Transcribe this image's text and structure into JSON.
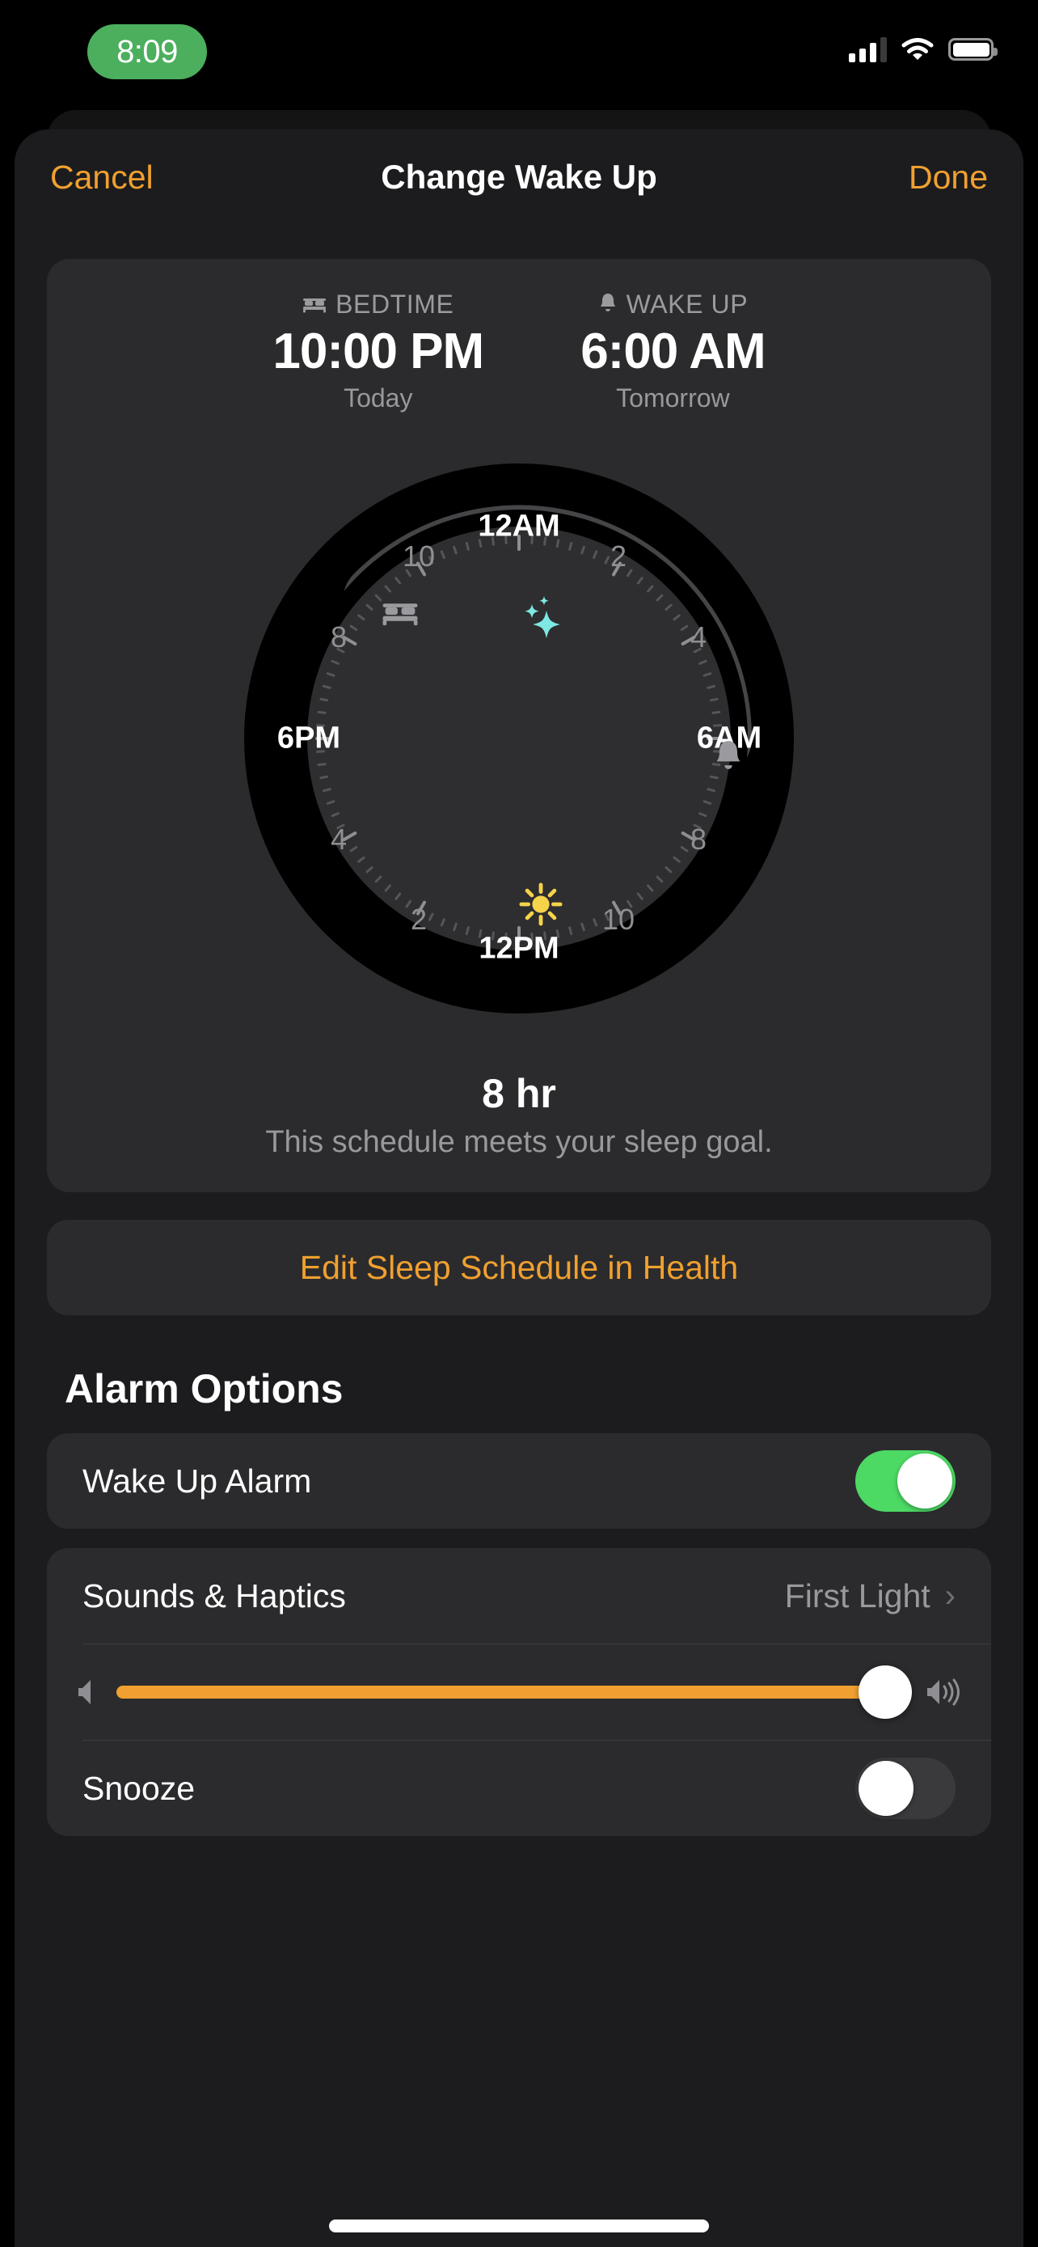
{
  "status_bar": {
    "time": "8:09",
    "time_pill_color": "#4CAF5E",
    "cellular_icon": "cellular-bars-icon",
    "wifi_icon": "wifi-icon",
    "battery_icon": "battery-full-icon"
  },
  "nav": {
    "cancel_label": "Cancel",
    "title": "Change Wake Up",
    "done_label": "Done",
    "accent_color": "#F0A030"
  },
  "schedule": {
    "bedtime": {
      "icon": "bed-icon",
      "header": "BEDTIME",
      "time": "10:00 PM",
      "day": "Today"
    },
    "wakeup": {
      "icon": "bell-icon",
      "header": "WAKE UP",
      "time": "6:00 AM",
      "day": "Tomorrow"
    }
  },
  "dial": {
    "labels": {
      "top": "12AM",
      "top_suffix": "AM",
      "right": "6AM",
      "bottom": "12PM",
      "left": "6PM",
      "minor": [
        "2",
        "4",
        "8",
        "10"
      ]
    },
    "night_icon": "sparkles-icon",
    "night_icon_color": "#7EE8E2",
    "day_icon": "sun-icon",
    "day_icon_color": "#F5D34A",
    "bedtime_handle_icon": "bed-icon",
    "wakeup_handle_icon": "bell-icon",
    "arc_start_hour": 22,
    "arc_end_hour": 6,
    "track_color": "#454548",
    "ring_color": "#000000",
    "face_color": "#2e2e30"
  },
  "duration": {
    "value": "8 hr",
    "note": "This schedule meets your sleep goal."
  },
  "edit_button": {
    "label": "Edit Sleep Schedule in Health"
  },
  "alarm_options": {
    "section_title": "Alarm Options",
    "wake_up_alarm": {
      "label": "Wake Up Alarm",
      "enabled": true
    },
    "sounds_haptics": {
      "label": "Sounds & Haptics",
      "value": "First Light",
      "chevron": "chevron-right-icon"
    },
    "volume": {
      "low_icon": "speaker-low-icon",
      "high_icon": "speaker-high-icon",
      "percent": 97,
      "fill_color": "#F0A030"
    },
    "snooze": {
      "label": "Snooze",
      "enabled": false
    }
  }
}
